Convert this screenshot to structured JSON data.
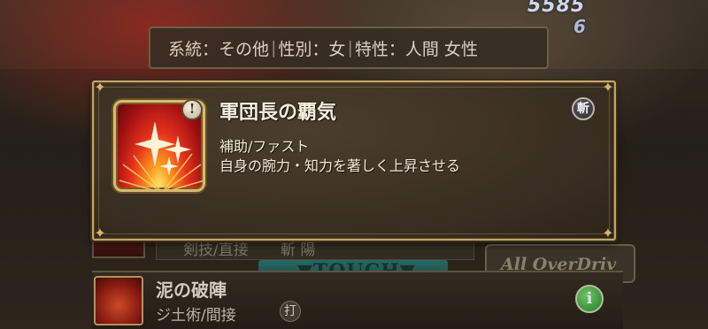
{
  "header": {
    "score": "5585",
    "score_sub": "6"
  },
  "info_bar": {
    "lineage_label": "系統：その他",
    "gender_label": "性別：女",
    "trait_label": "特性：人間 女性"
  },
  "popup": {
    "skill_name": "軍団長の覇気",
    "lock_badge": "!",
    "attribute_badge": "斬",
    "skill_type": "補助/ファスト",
    "skill_description": "自身の腕力・知力を著しく上昇させる"
  },
  "background": {
    "row1_type": "剣技/直接",
    "row1_attr": "斬 陽",
    "touch_label": "▼TOUCH▼",
    "overdrive_label": "All OverDriv",
    "row2_name": "泥の破陣",
    "row2_type": "ジ土術/間接",
    "row2_attr": "打",
    "info_button": "i"
  },
  "colors": {
    "popup_border": "#c4a466",
    "popup_bg": "#372d20",
    "text": "#f3ead8",
    "icon_red": "#e6321c",
    "icon_gold": "#ffe36a"
  }
}
